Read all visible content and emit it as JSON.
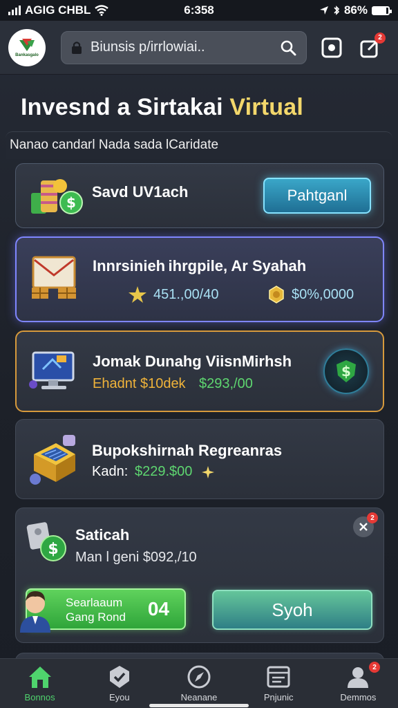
{
  "status_bar": {
    "carrier": "AGIG CHBL",
    "time": "6:358",
    "battery_percent": "86%",
    "battery_level": 0.86
  },
  "header": {
    "logo_text": "Bankasgalo",
    "search_text": "Biunsis p/irrlowiai..",
    "notification_count": "2"
  },
  "page": {
    "title_main": "Invesnd a Sirtakai",
    "title_accent": "Virtual",
    "subtitle": "Nanao candarl Nada sada lCaridate"
  },
  "cards": {
    "card1": {
      "title": "Savd UV1ach",
      "button_label": "Pahtganl",
      "icon": "coins-stack-icon"
    },
    "card2": {
      "title": "Innrsinieh ihrgpile, Ar Syahah",
      "stat1": "451.,00/40",
      "stat2": "$0%,0000",
      "icon": "envelope-icon"
    },
    "card3": {
      "title": "Jomak Dunahg ViisnMirhsh",
      "line_orange": "Ehadnt $10dek",
      "line_green": "$293,/00",
      "icon": "monitor-icon",
      "action_icon": "dollar-shield-icon"
    },
    "card4": {
      "title": "Bupokshirnah Regreanras",
      "line_prefix": "Kadn:",
      "line_value": "$229.$00",
      "icon": "treasure-chest-icon"
    },
    "card5": {
      "title": "Saticah",
      "line": "Man l geni $092,/10",
      "promo_line1": "Searlaaum",
      "promo_line2": "Gang Rond",
      "promo_number": "04",
      "button_label": "Syoh",
      "close_badge": "2",
      "icon": "money-bag-icon"
    }
  },
  "nav": {
    "items": [
      {
        "label": "Bonnos",
        "icon": "home-icon"
      },
      {
        "label": "Eyou",
        "icon": "shield-check-icon"
      },
      {
        "label": "Neanane",
        "icon": "compass-icon"
      },
      {
        "label": "Pnjunic",
        "icon": "document-icon"
      },
      {
        "label": "Demmos",
        "icon": "profile-icon",
        "badge": "2"
      }
    ]
  },
  "colors": {
    "accent_gold": "#f3d76b",
    "accent_green": "#4fd36d",
    "accent_cyan": "#86e3ff",
    "accent_purple": "#7f86ff",
    "accent_orange": "#d79a3c"
  }
}
